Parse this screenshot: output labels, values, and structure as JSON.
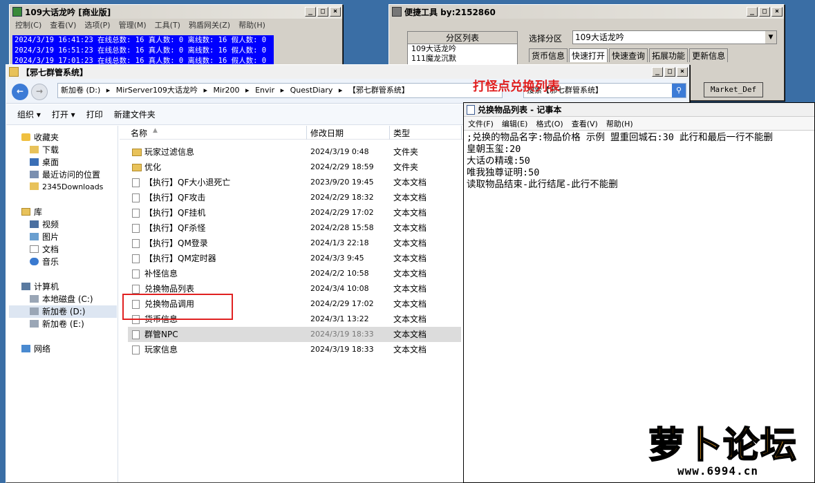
{
  "w1": {
    "title": "109大话龙吟 [商业版]",
    "menu": [
      "控制(C)",
      "查看(V)",
      "选项(P)",
      "管理(M)",
      "工具(T)",
      "鸦盾网关(Z)",
      "帮助(H)"
    ],
    "log": [
      "2024/3/19 16:41:23 在线总数: 16 真人数: 0 离线数: 16 假人数: 0",
      "2024/3/19 16:51:23 在线总数: 16 真人数: 0 离线数: 16 假人数: 0",
      "2024/3/19 17:01:23 在线总数: 16 真人数: 0 离线数: 16 假人数: 0"
    ]
  },
  "w2": {
    "title": "便捷工具  by:2152860",
    "plist_header": "分区列表",
    "plist_items": [
      "109大话龙吟",
      "111魔龙沉默"
    ],
    "select_label": "选择分区",
    "select_value": "109大话龙吟",
    "tabs": [
      "货币信息",
      "快速打开",
      "快速查询",
      "拓展功能",
      "更新信息"
    ],
    "market_btn": "Market_Def"
  },
  "w3": {
    "title": "【邪七群管系统】",
    "crumbs": [
      "新加卷 (D:)",
      "▸",
      "MirServer109大话龙吟",
      "▸",
      "Mir200",
      "▸",
      "Envir",
      "▸",
      "QuestDiary",
      "▸",
      "【邪七群管系统】"
    ],
    "search": "搜索【邪七群管系统】",
    "toolbar": [
      "组织 ▾",
      "打开 ▾",
      "打印",
      "新建文件夹"
    ],
    "tree": {
      "favorites": "收藏夹",
      "fav_items": [
        "下载",
        "桌面",
        "最近访问的位置",
        "2345Downloads"
      ],
      "library": "库",
      "lib_items": [
        "视频",
        "图片",
        "文档",
        "音乐"
      ],
      "computer": "计算机",
      "comp_items": [
        "本地磁盘 (C:)",
        "新加卷 (D:)",
        "新加卷 (E:)"
      ],
      "network": "网络"
    },
    "cols": {
      "name": "名称",
      "date": "修改日期",
      "type": "类型"
    },
    "files": [
      {
        "name": "玩家过滤信息",
        "date": "2024/3/19 0:48",
        "type": "文件夹"
      },
      {
        "name": "优化",
        "date": "2024/2/29 18:59",
        "type": "文件夹"
      },
      {
        "name": "【执行】QF大小退死亡",
        "date": "2023/9/20 19:45",
        "type": "文本文档"
      },
      {
        "name": "【执行】QF攻击",
        "date": "2024/2/29 18:32",
        "type": "文本文档"
      },
      {
        "name": "【执行】QF挂机",
        "date": "2024/2/29 17:02",
        "type": "文本文档"
      },
      {
        "name": "【执行】QF杀怪",
        "date": "2024/2/28 15:58",
        "type": "文本文档"
      },
      {
        "name": "【执行】QM登录",
        "date": "2024/1/3 22:18",
        "type": "文本文档"
      },
      {
        "name": "【执行】QM定时器",
        "date": "2024/3/3 9:45",
        "type": "文本文档"
      },
      {
        "name": "补怪信息",
        "date": "2024/2/2 10:58",
        "type": "文本文档"
      },
      {
        "name": "兑换物品列表",
        "date": "2024/3/4 10:08",
        "type": "文本文档"
      },
      {
        "name": "兑换物品调用",
        "date": "2024/2/29 17:02",
        "type": "文本文档"
      },
      {
        "name": "货币信息",
        "date": "2024/3/1 13:22",
        "type": "文本文档"
      },
      {
        "name": "群管NPC",
        "date": "2024/3/19 18:33",
        "type": "文本文档"
      },
      {
        "name": "玩家信息",
        "date": "2024/3/19 18:33",
        "type": "文本文档"
      }
    ]
  },
  "overlay_label": "打怪点兑换列表",
  "notepad": {
    "title": "兑换物品列表 - 记事本",
    "menu": [
      "文件(F)",
      "编辑(E)",
      "格式(O)",
      "查看(V)",
      "帮助(H)"
    ],
    "lines": [
      ";兑换的物品名字:物品价格   示例   盟重回城石:30    此行和最后一行不能删",
      "皇朝玉玺:20",
      "大话の精魂:50",
      "唯我独尊证明:50",
      "读取物品结束-此行结尾-此行不能删"
    ]
  },
  "logo": {
    "text": "萝卜论坛",
    "url": "www.6994.cn"
  }
}
